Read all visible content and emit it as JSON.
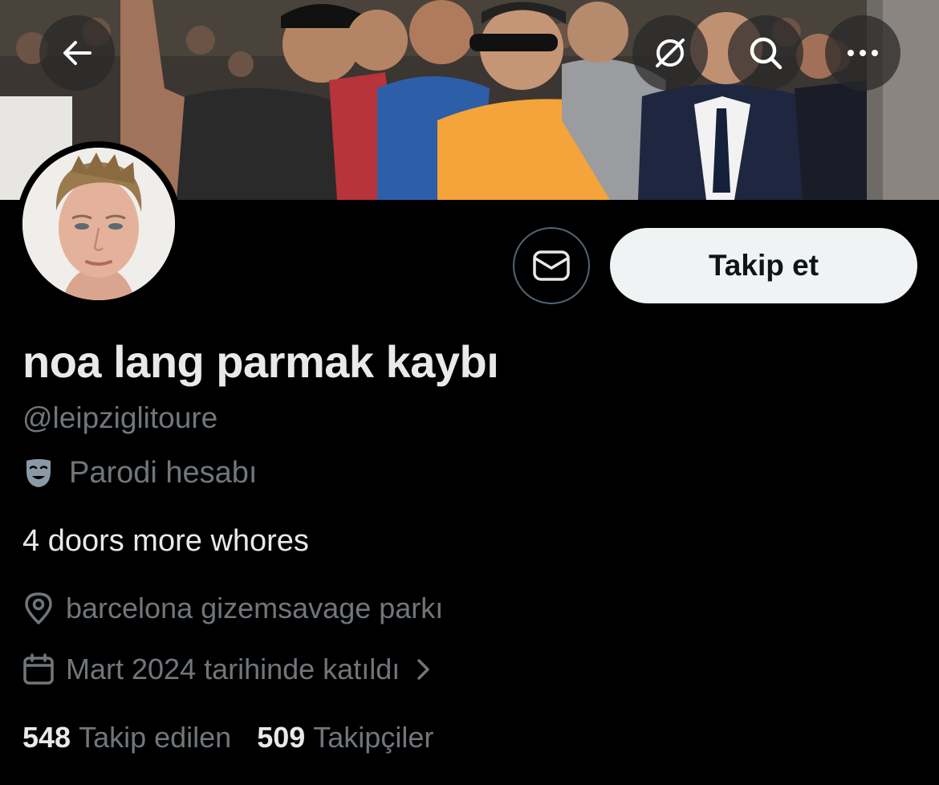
{
  "header": {
    "back_icon": "arrow-left-icon",
    "unfollow_icon": "circle-slash-icon",
    "search_icon": "search-icon",
    "more_icon": "more-dots-icon"
  },
  "profile": {
    "display_name": "noa lang parmak kaybı",
    "handle": "@leipziglitoure",
    "parody_label": "Parodi hesabı",
    "bio": "4 doors more whores",
    "location": "barcelona gizemsavage parkı",
    "joined": "Mart 2024 tarihinde katıldı"
  },
  "actions": {
    "follow_label": "Takip et",
    "message_icon": "envelope-icon"
  },
  "stats": {
    "following_count": "548",
    "following_label": "Takip edilen",
    "followers_count": "509",
    "followers_label": "Takipçiler"
  },
  "colors": {
    "background": "#000000",
    "primary_text": "#e7e9ea",
    "secondary_text": "#71767b",
    "follow_button_bg": "#eff3f4",
    "follow_button_text": "#0f1419"
  }
}
